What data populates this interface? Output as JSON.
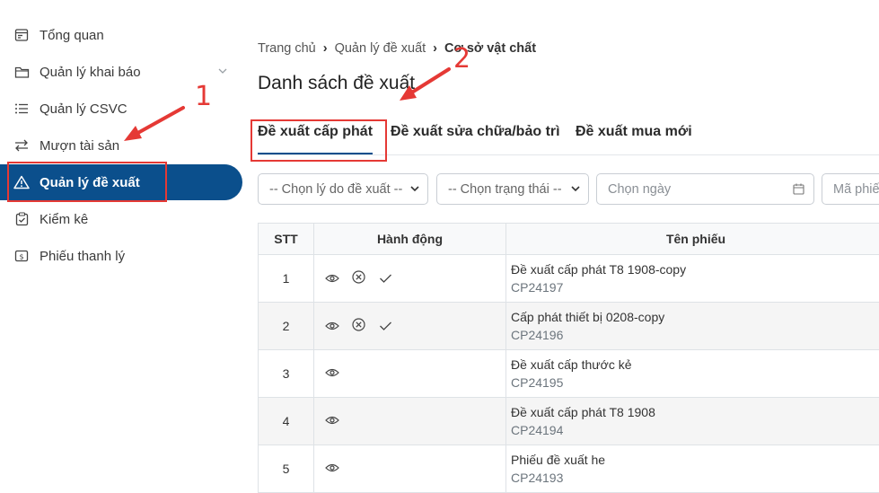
{
  "sidebar": {
    "items": [
      {
        "label": "Tổng quan",
        "icon": "dashboard-icon"
      },
      {
        "label": "Quản lý khai báo",
        "icon": "folder-icon"
      },
      {
        "label": "Quản lý CSVC",
        "icon": "list-icon"
      },
      {
        "label": "Mượn tài sản",
        "icon": "swap-arrows-icon"
      },
      {
        "label": "Quản lý đề xuất",
        "icon": "warning-triangle-icon",
        "active": true
      },
      {
        "label": "Kiểm kê",
        "icon": "checklist-icon"
      },
      {
        "label": "Phiếu thanh lý",
        "icon": "receipt-icon"
      }
    ]
  },
  "breadcrumb": {
    "home": "Trang chủ",
    "section": "Quản lý đề xuất",
    "current": "Cơ sở vật chất"
  },
  "page_title": "Danh sách đề xuất",
  "tabs": [
    {
      "label": "Đề xuất cấp phát",
      "active": true
    },
    {
      "label": "Đề xuất sửa chữa/bảo trì"
    },
    {
      "label": "Đề xuất mua mới"
    }
  ],
  "filters": {
    "reason": "-- Chọn lý do đề xuất --",
    "status": "-- Chọn trạng thái --",
    "date_placeholder": "Chọn ngày",
    "code_placeholder": "Mã phiếu"
  },
  "table": {
    "headers": [
      "STT",
      "Hành động",
      "Tên phiếu"
    ],
    "rows": [
      {
        "stt": "1",
        "name": "Đề xuất cấp phát T8 1908-copy",
        "code": "CP24197",
        "actions": [
          "view",
          "reject",
          "approve"
        ]
      },
      {
        "stt": "2",
        "name": "Cấp phát thiết bị 0208-copy",
        "code": "CP24196",
        "actions": [
          "view",
          "reject",
          "approve"
        ]
      },
      {
        "stt": "3",
        "name": "Đề xuất cấp thước kẻ",
        "code": "CP24195",
        "actions": [
          "view"
        ]
      },
      {
        "stt": "4",
        "name": "Đề xuất cấp phát T8 1908",
        "code": "CP24194",
        "actions": [
          "view"
        ]
      },
      {
        "stt": "5",
        "name": "Phiếu đề xuất he",
        "code": "CP24193",
        "actions": [
          "view"
        ]
      }
    ]
  },
  "annotations": {
    "step1": "1",
    "step2": "2"
  },
  "colors": {
    "accent": "#0b4f8c",
    "annotation": "#e53935"
  }
}
